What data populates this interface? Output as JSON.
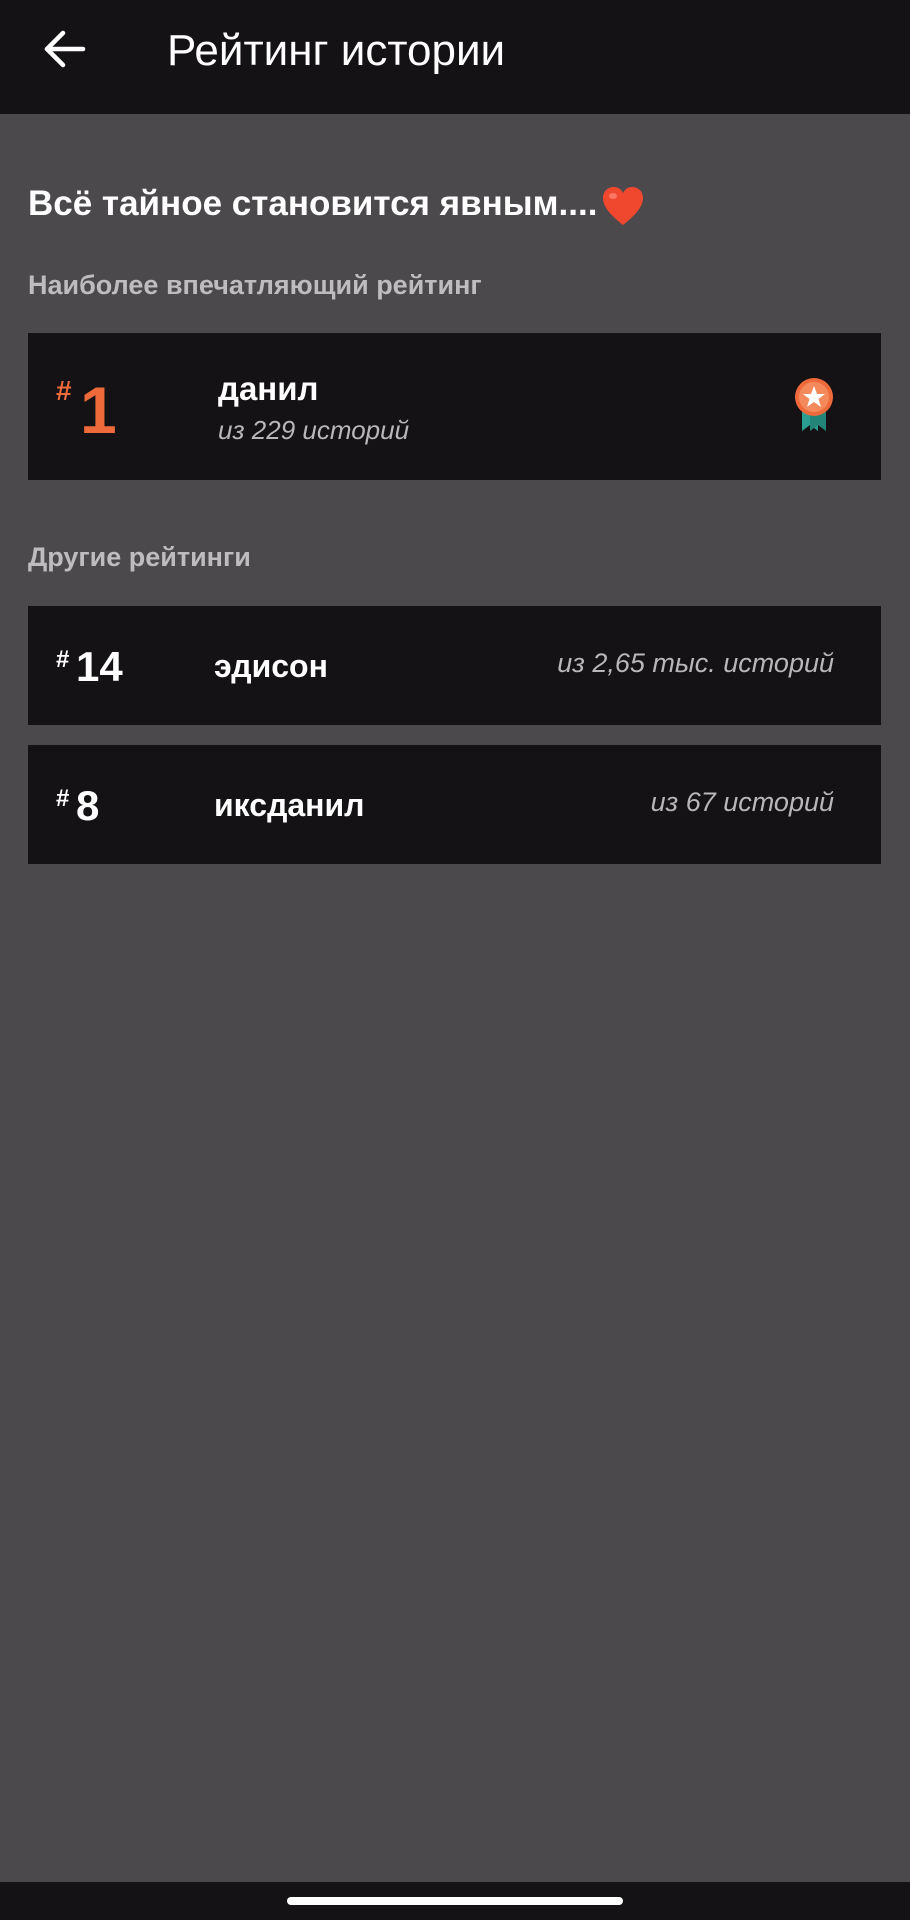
{
  "app_bar": {
    "title": "Рейтинг истории"
  },
  "story": {
    "title": "Всё тайное становится явным....",
    "emoji": "heart-icon"
  },
  "best": {
    "section_label": "Наиболее впечатляющий рейтинг",
    "rank_hash": "#",
    "rank": "1",
    "name": "данил",
    "subtitle": "из 229 историй",
    "badge": "medal-icon"
  },
  "others": {
    "section_label": "Другие рейтинги",
    "items": [
      {
        "rank_hash": "#",
        "rank": "14",
        "name": "эдисон",
        "count": "из 2,65 тыс. историй"
      },
      {
        "rank_hash": "#",
        "rank": "8",
        "name": "иксданил",
        "count": "из 67 историй"
      }
    ]
  },
  "colors": {
    "background": "#4b494c",
    "bar": "#141215",
    "accent": "#ee6a3a",
    "muted_text": "#b9b6ba"
  }
}
